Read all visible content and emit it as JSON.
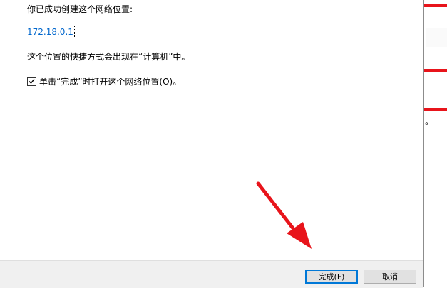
{
  "wizard": {
    "success_message": "你已成功创建这个网络位置:",
    "location_link": "172.18.0.1",
    "info_text": "这个位置的快捷方式会出现在“计算机”中。",
    "open_checkbox": {
      "label": "单击“完成”时打开这个网络位置(O)。",
      "checked": true
    }
  },
  "footer": {
    "finish_label": "完成(F)",
    "cancel_label": "取消"
  },
  "background_window": {
    "fragment_text": "。"
  },
  "colors": {
    "link": "#0066cc",
    "annotation_arrow": "#e8141b",
    "footer_bg": "#f0f0f0",
    "default_button_border": "#0078d7"
  }
}
